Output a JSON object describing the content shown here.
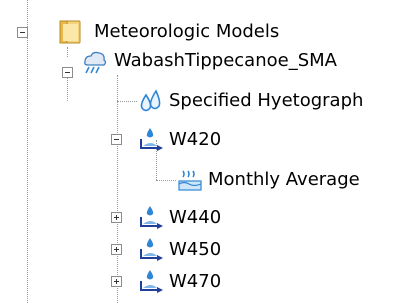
{
  "tree": {
    "root": {
      "label": "Meteorologic Models",
      "icon": "folder-icon",
      "expanded": true
    },
    "model": {
      "label": "WabashTippecanoe_SMA",
      "icon": "meteorologic-model-icon",
      "expanded": true
    },
    "precip": {
      "label": "Specified Hyetograph",
      "icon": "precipitation-drops-icon"
    },
    "subbasins": [
      {
        "label": "W420",
        "icon": "subbasin-icon",
        "expanded": true,
        "child": {
          "label": "Monthly Average",
          "icon": "evapotranspiration-icon"
        }
      },
      {
        "label": "W440",
        "icon": "subbasin-icon",
        "expanded": false
      },
      {
        "label": "W450",
        "icon": "subbasin-icon",
        "expanded": false
      },
      {
        "label": "W470",
        "icon": "subbasin-icon",
        "expanded": false
      }
    ]
  },
  "colors": {
    "folder": "#e8b94a",
    "drop": "#2f86d6",
    "arrow": "#1f3f9c",
    "tree_lines": "#9a9a9a"
  }
}
